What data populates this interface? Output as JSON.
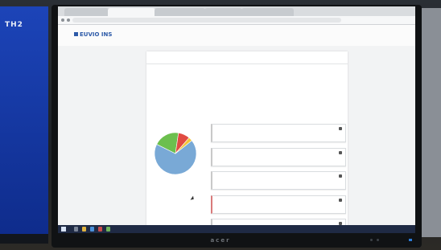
{
  "left_monitor": {
    "text": "TH2"
  },
  "monitor": {
    "brand": "acer"
  },
  "browser": {
    "tabs": [
      "",
      "",
      "",
      "",
      ""
    ],
    "url": ""
  },
  "site": {
    "logo": "EUVIO INS",
    "top_links": [
      "",
      "",
      "",
      "",
      ""
    ]
  },
  "panel": {
    "menu": [
      "",
      "",
      "",
      "",
      ""
    ],
    "breadcrumb": "",
    "view_toggle": "",
    "question": "",
    "counts": [
      "",
      "",
      "",
      "",
      ""
    ]
  },
  "chart_data": {
    "type": "pie",
    "labels": [
      "",
      "",
      "",
      "",
      ""
    ],
    "values": [
      68,
      20,
      9,
      3,
      0
    ],
    "colors": [
      "#79a9d6",
      "#6cbf4e",
      "#e14b42",
      "#f2c43a",
      "#bbbbbb"
    ]
  }
}
